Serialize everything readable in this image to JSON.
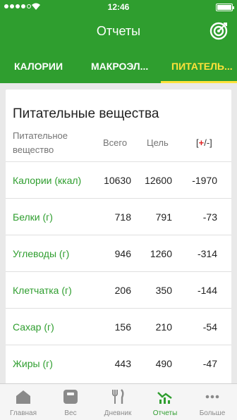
{
  "status_bar": {
    "time": "12:46"
  },
  "app_bar": {
    "title": "Отчеты"
  },
  "tabs": [
    {
      "label": "КАЛОРИИ",
      "active": false
    },
    {
      "label": "МАКРОЭЛ...",
      "active": false
    },
    {
      "label": "ПИТАТЕЛЬ...",
      "active": true
    }
  ],
  "card": {
    "title": "Питательные вещества",
    "headers": {
      "nutrient_line1": "Питательное",
      "nutrient_line2": "вещество",
      "total": "Всего",
      "goal": "Цель",
      "bracket_open": "[",
      "plus": "+",
      "slash_minus": "/-]"
    },
    "rows": [
      {
        "name": "Калории (ккал)",
        "total": "10630",
        "goal": "12600",
        "diff": "-1970"
      },
      {
        "name": "Белки (г)",
        "total": "718",
        "goal": "791",
        "diff": "-73"
      },
      {
        "name": "Углеводы (г)",
        "total": "946",
        "goal": "1260",
        "diff": "-314"
      },
      {
        "name": "Клетчатка (г)",
        "total": "206",
        "goal": "350",
        "diff": "-144"
      },
      {
        "name": "Сахар (г)",
        "total": "156",
        "goal": "210",
        "diff": "-54"
      },
      {
        "name": "Жиры (г)",
        "total": "443",
        "goal": "490",
        "diff": "-47"
      }
    ]
  },
  "bottom_nav": [
    {
      "label": "Главная",
      "icon": "home-icon",
      "active": false
    },
    {
      "label": "Вес",
      "icon": "scale-icon",
      "active": false
    },
    {
      "label": "Дневник",
      "icon": "fork-knife-icon",
      "active": false
    },
    {
      "label": "Отчеты",
      "icon": "reports-chart-icon",
      "active": true
    },
    {
      "label": "Больше",
      "icon": "more-icon",
      "active": false
    }
  ],
  "colors": {
    "brand_green": "#2f9e2f",
    "active_tab": "#ffe23a",
    "plus_red": "#e02020"
  }
}
